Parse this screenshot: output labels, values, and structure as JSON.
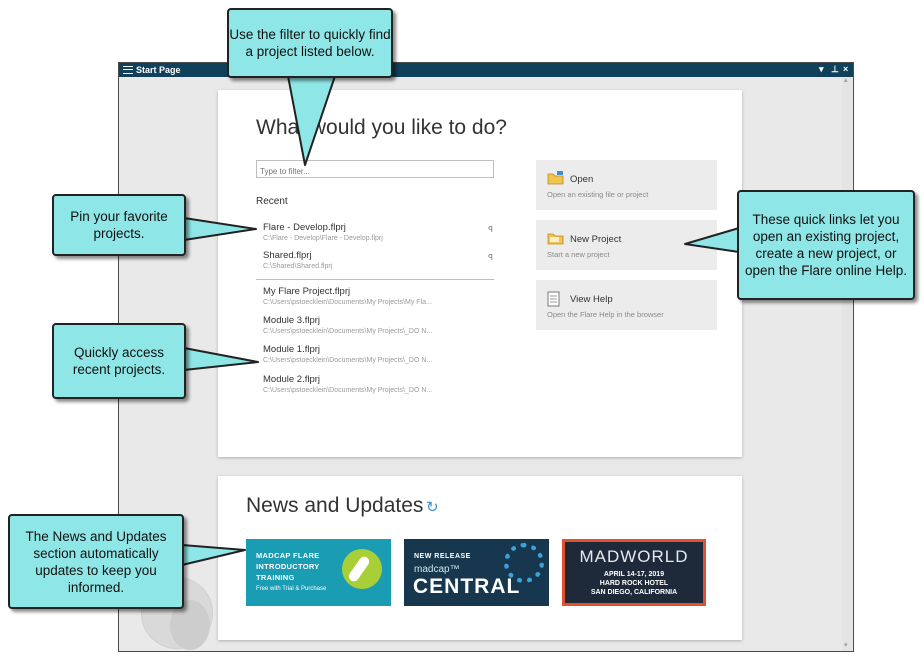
{
  "window": {
    "title": "Start Page",
    "controls": {
      "dropdown": "▾",
      "pin": "⊥",
      "close": "×"
    }
  },
  "main": {
    "heading": "What would you like to do?",
    "filter_placeholder": "Type to filter...",
    "recent_label": "Recent",
    "pinned_projects": [
      {
        "name": "Flare - Develop.flprj",
        "path": "C:\\Flare - Develop\\Flare - Develop.flprj"
      },
      {
        "name": "Shared.flprj",
        "path": "C:\\Shared\\Shared.flprj"
      }
    ],
    "recent_projects": [
      {
        "name": "My Flare Project.flprj",
        "path": "C:\\Users\\pstoecklein\\Documents\\My Projects\\My Fla..."
      },
      {
        "name": "Module 3.flprj",
        "path": "C:\\Users\\pstoecklein\\Documents\\My Projects\\_DO N..."
      },
      {
        "name": "Module 1.flprj",
        "path": "C:\\Users\\pstoecklein\\Documents\\My Projects\\_DO N..."
      },
      {
        "name": "Module 2.flprj",
        "path": "C:\\Users\\pstoecklein\\Documents\\My Projects\\_DO N..."
      }
    ],
    "quick_links": [
      {
        "title": "Open",
        "desc": "Open an existing file or project",
        "icon": "folder-open-icon"
      },
      {
        "title": "New Project",
        "desc": "Start a new project",
        "icon": "new-project-icon"
      },
      {
        "title": "View Help",
        "desc": "Open the Flare Help in the browser",
        "icon": "help-document-icon"
      }
    ]
  },
  "news": {
    "title": "News and Updates",
    "refresh_icon": "↻",
    "banners": {
      "training": {
        "line1": "MADCAP FLARE",
        "line2": "INTRODUCTORY",
        "line3": "TRAINING",
        "sub": "Free with Trial & Purchase"
      },
      "central": {
        "tag": "NEW RELEASE",
        "brand": "madcap™",
        "name": "CENTRAL"
      },
      "madworld": {
        "name": "MADWORLD",
        "dates": "APRIL 14-17, 2019",
        "venue": "HARD ROCK HOTEL",
        "city": "SAN DIEGO, CALIFORNIA"
      }
    }
  },
  "callouts": {
    "filter": "Use the filter to quickly find a project listed below.",
    "pin": "Pin your favorite projects.",
    "recent": "Quickly access recent projects.",
    "quick_links": "These quick links let you open an existing project, create a new project, or open the Flare online Help.",
    "news": "The News and Updates section automatically updates to keep you informed."
  },
  "colors": {
    "titlebar": "#10405a",
    "callout_fill": "#8fe6e6",
    "accent": "#3d8fd4"
  }
}
